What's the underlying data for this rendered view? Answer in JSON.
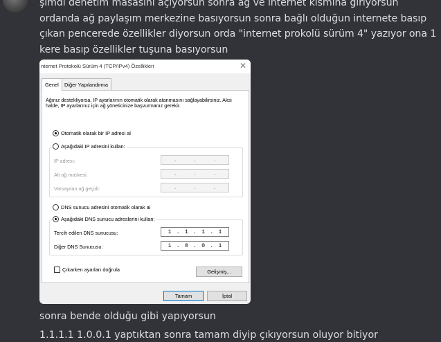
{
  "chat": {
    "message1": "şimdi denetim masasını açıyorsun sonra ağ ve internet kısmına giriyorsun ordanda ağ paylaşım merkezine basıyorsun sonra bağlı olduğun internete basıp çıkan pencerede özellikler diyorsun orda \"internet prokolü sürüm 4\" yazıyor ona 1 kere basıp özellikler tuşuna basıyorsun",
    "message2": "sonra bende olduğu gibi yapıyorsun",
    "message3": "1.1.1.1 1.0.0.1 yaptıktan sonra tamam diyip çıkıyorsun oluyor bitiyor"
  },
  "dialog": {
    "title": "nternet Protokolü Sürüm 4 (TCP/IPv4) Özellikleri",
    "close_glyph": "✕",
    "tabs": [
      "Genel",
      "Diğer Yapılandırma"
    ],
    "description": "Ağınız destekliyorsa, IP ayarlarının otomatik olarak atanmasını sağlayabilirsiniz. Aksi halde, IP ayarlarınız için ağ yöneticinize başvurmanız gerekir.",
    "ip_auto_label": "Otomatik olarak bir IP adresi al",
    "ip_manual_label": "Aşağıdaki IP adresini kullan:",
    "ip_address_label": "IP adresi:",
    "subnet_label": "Alt ağ maskesi:",
    "gateway_label": "Varsayılan ağ geçidi:",
    "dns_auto_label": "DNS sunucu adresini otomatik olarak al",
    "dns_manual_label": "Aşağıdaki DNS sunucu adreslerini kullan:",
    "preferred_dns_label": "Tercih edilen DNS sunucusu:",
    "alternate_dns_label": "Diğer DNS Sunucusu:",
    "preferred_dns": [
      "1",
      "1",
      "1",
      "1"
    ],
    "alternate_dns": [
      "1",
      "0",
      "0",
      "1"
    ],
    "validate_label": "Çıkarken ayarları doğrula",
    "advanced_button": "Gelişmiş...",
    "ok_button": "Tamam",
    "cancel_button": "İptal",
    "ip_auto_selected": true,
    "dns_manual_selected": true,
    "validate_checked": false
  }
}
